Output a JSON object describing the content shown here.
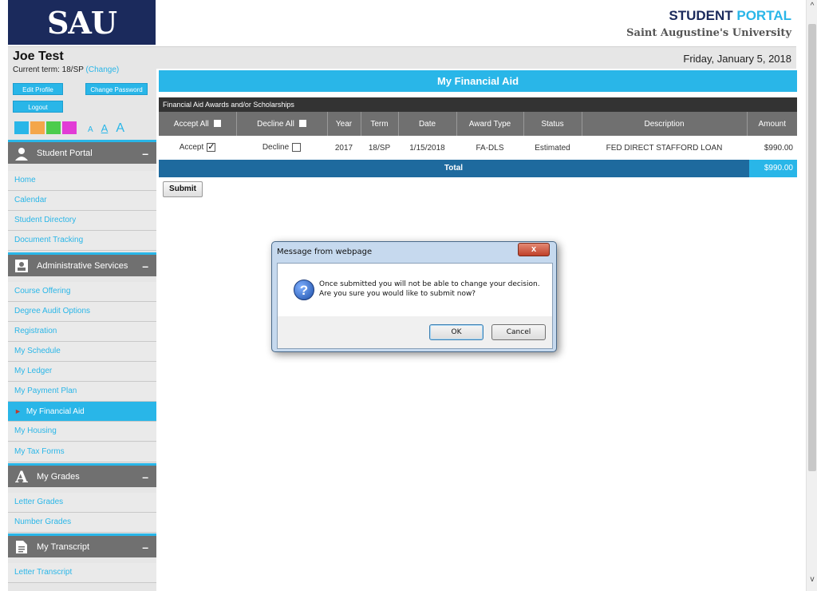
{
  "header": {
    "logo": "SAU",
    "portal_title_part1": "STUDENT",
    "portal_title_part2": "PORTAL",
    "university": "Saint Augustine's University"
  },
  "topbar": {
    "user_name": "Joe Test",
    "date": "Friday, January 5, 2018"
  },
  "profile": {
    "term_label": "Current term: 18/SP",
    "change_link": "(Change)",
    "edit_profile": "Edit Profile",
    "change_password": "Change Password",
    "logout": "Logout",
    "swatch_colors": [
      "#29b6e8",
      "#f4a64a",
      "#4ccc4c",
      "#e23cd6"
    ],
    "font_sizes": [
      "A",
      "A",
      "A"
    ]
  },
  "sidebar": {
    "sections": [
      {
        "title": "Student Portal",
        "icon": "person-icon",
        "toggle": "–",
        "items": [
          "Home",
          "Calendar",
          "Student Directory",
          "Document Tracking"
        ]
      },
      {
        "title": "Administrative Services",
        "icon": "admin-icon",
        "toggle": "–",
        "items": [
          "Course Offering",
          "Degree Audit Options",
          "Registration",
          "My Schedule",
          "My Ledger",
          "My Payment Plan",
          "My Financial Aid",
          "My Housing",
          "My Tax Forms"
        ]
      },
      {
        "title": "My Grades",
        "icon": "grades-icon",
        "toggle": "–",
        "items": [
          "Letter Grades",
          "Number Grades"
        ]
      },
      {
        "title": "My Transcript",
        "icon": "document-icon",
        "toggle": "–",
        "items": [
          "Letter Transcript"
        ]
      }
    ],
    "active_item": "My Financial Aid"
  },
  "main": {
    "page_title": "My Financial Aid",
    "table_caption": "Financial Aid Awards and/or Scholarships",
    "columns": [
      "Accept All",
      "Decline All",
      "Year",
      "Term",
      "Date",
      "Award Type",
      "Status",
      "Description",
      "Amount"
    ],
    "rows": [
      {
        "accept": "Accept",
        "accept_checked": true,
        "decline": "Decline",
        "decline_checked": false,
        "year": "2017",
        "term": "18/SP",
        "date": "1/15/2018",
        "award_type": "FA-DLS",
        "status": "Estimated",
        "description": "FED DIRECT STAFFORD LOAN",
        "amount": "$990.00"
      }
    ],
    "total_label": "Total",
    "total_amount": "$990.00",
    "submit_label": "Submit"
  },
  "dialog": {
    "title": "Message from webpage",
    "close_glyph": "x",
    "icon": "question-icon",
    "message_line1": "Once submitted you will not be able to change your decision.",
    "message_line2": "Are you sure you would like to submit now?",
    "ok_label": "OK",
    "cancel_label": "Cancel"
  },
  "scrollbar": {
    "up_glyph": "^",
    "down_glyph": "v"
  }
}
